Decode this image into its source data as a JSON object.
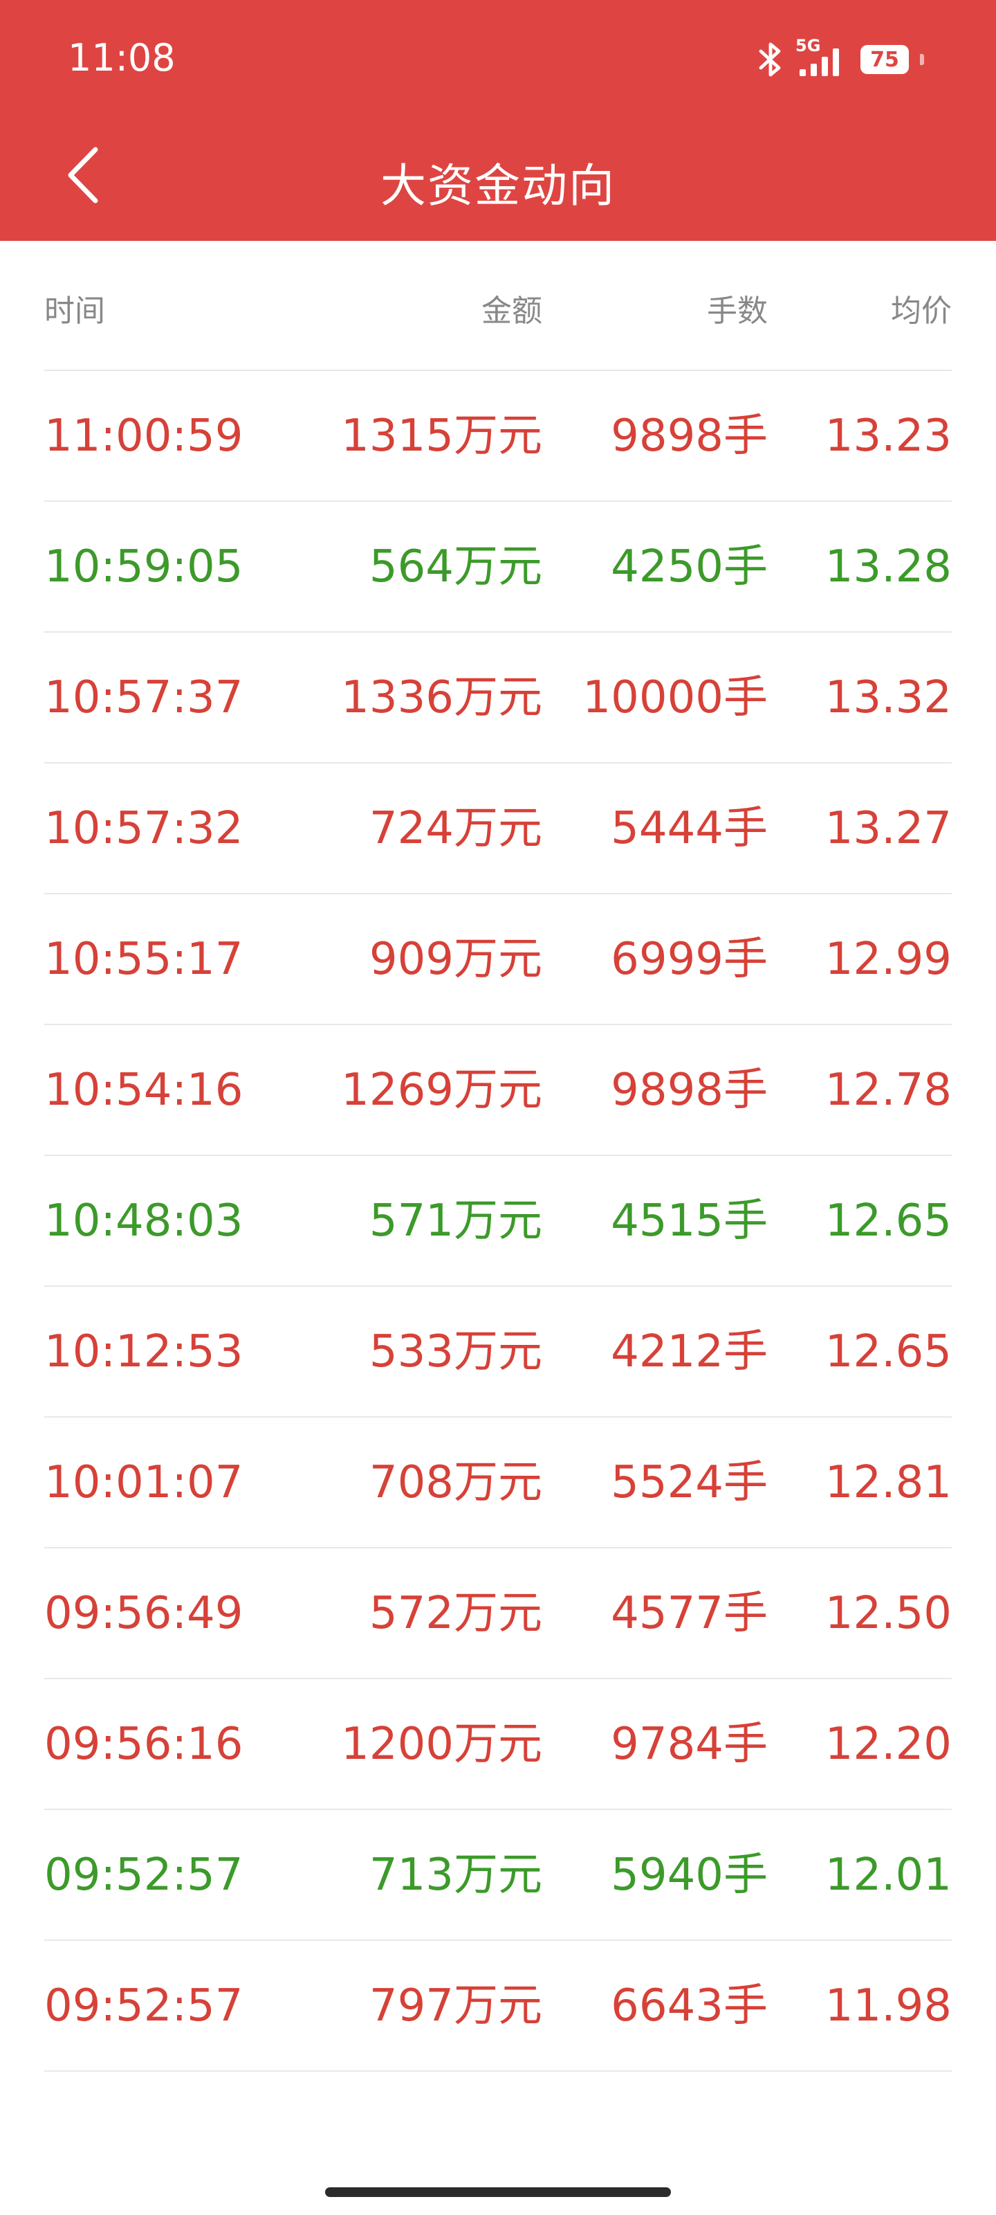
{
  "status_bar": {
    "time": "11:08",
    "network": "5G",
    "battery": "75"
  },
  "header": {
    "title": "大资金动向"
  },
  "table": {
    "columns": [
      "时间",
      "金额",
      "手数",
      "均价"
    ],
    "rows": [
      {
        "time": "11:00:59",
        "amount": "1315万元",
        "lots": "9898手",
        "price": "13.23",
        "color": "red"
      },
      {
        "time": "10:59:05",
        "amount": "564万元",
        "lots": "4250手",
        "price": "13.28",
        "color": "green"
      },
      {
        "time": "10:57:37",
        "amount": "1336万元",
        "lots": "10000手",
        "price": "13.32",
        "color": "red"
      },
      {
        "time": "10:57:32",
        "amount": "724万元",
        "lots": "5444手",
        "price": "13.27",
        "color": "red"
      },
      {
        "time": "10:55:17",
        "amount": "909万元",
        "lots": "6999手",
        "price": "12.99",
        "color": "red"
      },
      {
        "time": "10:54:16",
        "amount": "1269万元",
        "lots": "9898手",
        "price": "12.78",
        "color": "red"
      },
      {
        "time": "10:48:03",
        "amount": "571万元",
        "lots": "4515手",
        "price": "12.65",
        "color": "green"
      },
      {
        "time": "10:12:53",
        "amount": "533万元",
        "lots": "4212手",
        "price": "12.65",
        "color": "red"
      },
      {
        "time": "10:01:07",
        "amount": "708万元",
        "lots": "5524手",
        "price": "12.81",
        "color": "red"
      },
      {
        "time": "09:56:49",
        "amount": "572万元",
        "lots": "4577手",
        "price": "12.50",
        "color": "red"
      },
      {
        "time": "09:56:16",
        "amount": "1200万元",
        "lots": "9784手",
        "price": "12.20",
        "color": "red"
      },
      {
        "time": "09:52:57",
        "amount": "713万元",
        "lots": "5940手",
        "price": "12.01",
        "color": "green"
      },
      {
        "time": "09:52:57",
        "amount": "797万元",
        "lots": "6643手",
        "price": "11.98",
        "color": "red"
      }
    ]
  },
  "colors": {
    "header_bg": "#de4542",
    "up": "#d64138",
    "down": "#3c9a2a"
  },
  "icons": {
    "back": "chevron-left-icon",
    "bluetooth": "bluetooth-icon",
    "signal": "signal-icon"
  }
}
